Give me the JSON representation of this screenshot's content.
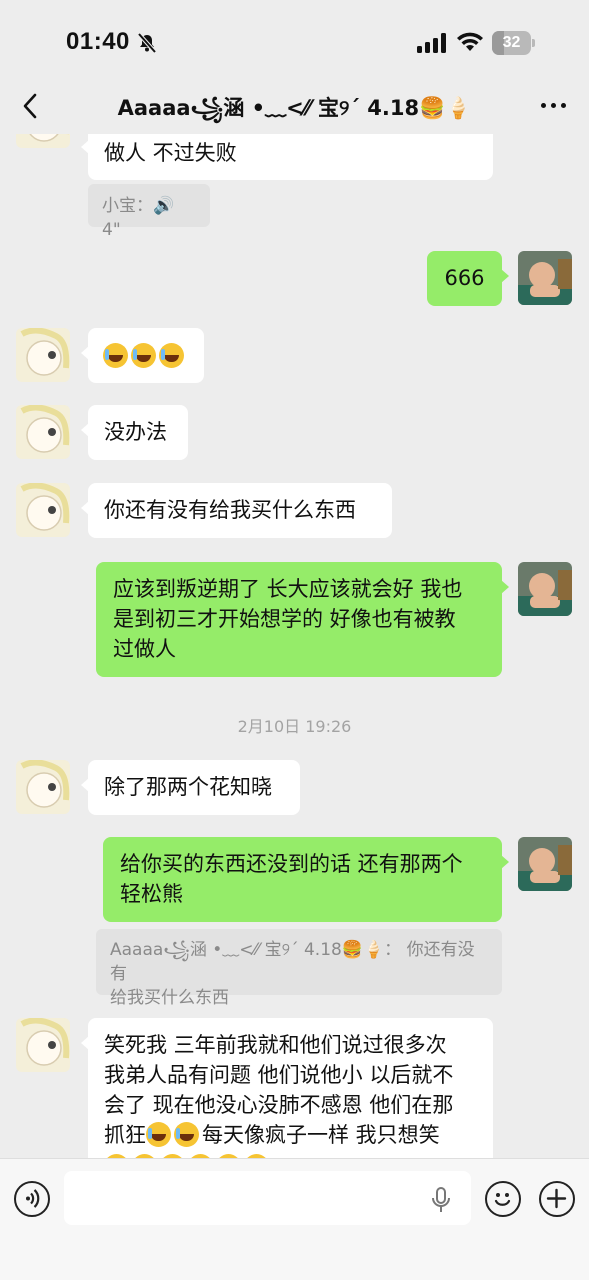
{
  "status_bar": {
    "time": "01:40",
    "battery": "32",
    "battery_level": 0.32
  },
  "header": {
    "title": "Aaaaa꧁涵 •﹏<⁄⁄ 宝୨ˊ 4.18🍔🍦"
  },
  "messages": {
    "m1": {
      "side": "in",
      "text": "做人 不过失败"
    },
    "voice_quote": {
      "text": "小宝：🔊 4\""
    },
    "m2": {
      "side": "out",
      "text": "666"
    },
    "m3": {
      "side": "in",
      "emoji": "😭😭😭"
    },
    "m4": {
      "side": "in",
      "text": "没办法"
    },
    "m5": {
      "side": "in",
      "text": "你还有没有给我买什么东西"
    },
    "m6": {
      "side": "out",
      "line1": "应该到叛逆期了 长大应该就会好 我也",
      "line2": "是到初三才开始想学的 好像也有被教",
      "line3": "过做人"
    },
    "time_sep": "2月10日 19:26",
    "m7": {
      "side": "in",
      "text": "除了那两个花知晓"
    },
    "m8": {
      "side": "out",
      "line1": "给你买的东西还没到的话 还有那两个",
      "line2": "轻松熊"
    },
    "quote": {
      "line1": "Aaaaa꧁涵 •﹏<⁄⁄ 宝୨ˊ 4.18🍔🍦： 你还有没有",
      "line2": "给我买什么东西"
    },
    "m9": {
      "side": "in",
      "line1": "笑死我 三年前我就和他们说过很多次",
      "line2": "我弟人品有问题 他们说他小 以后就不",
      "line3": "会了 现在他没心没肺不感恩 他们在那",
      "line4_a": "抓狂",
      "line4_b": "每天像疯子一样 我只想笑"
    }
  },
  "input": {
    "placeholder": ""
  },
  "colors": {
    "background": "#ededed",
    "outgoing_bubble": "#95ec69",
    "incoming_bubble": "#ffffff",
    "timestamp": "#a3a3a3"
  },
  "icons": [
    "back-icon",
    "more-icon",
    "voice-icon",
    "mic-icon",
    "emoji-icon",
    "plus-icon",
    "bell-slash-icon",
    "signal-icon",
    "wifi-icon",
    "battery-icon"
  ]
}
